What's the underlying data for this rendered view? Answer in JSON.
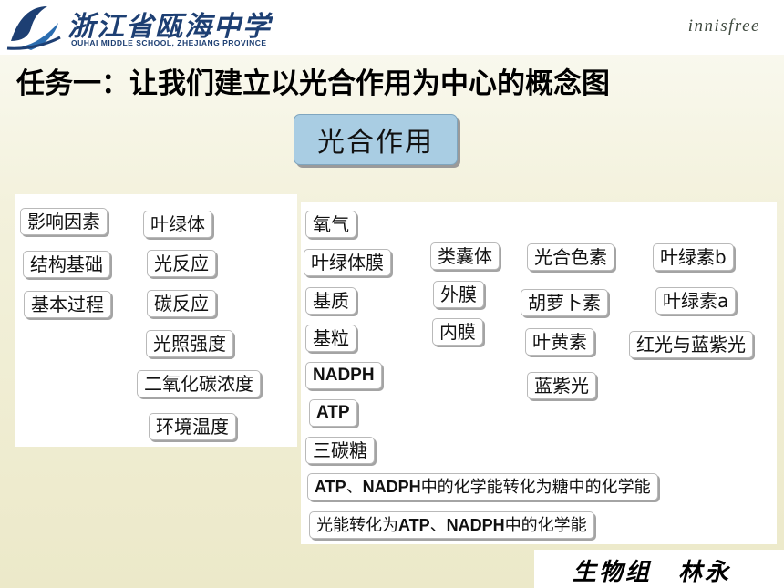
{
  "header": {
    "school_name_cn": "浙江省瓯海中学",
    "school_name_en": "OUHAI MIDDLE SCHOOL, ZHEJIANG PROVINCE",
    "brand": "innisfree"
  },
  "title": "任务一：让我们建立以光合作用为中心的概念图",
  "center_concept": "光合作用",
  "left_terms": [
    "影响因素",
    "叶绿体",
    "结构基础",
    "光反应",
    "基本过程",
    "碳反应",
    "光照强度",
    "二氧化碳浓度",
    "环境温度"
  ],
  "right_terms": [
    "氧气",
    "叶绿体膜",
    "基质",
    "基粒",
    "NADPH",
    "ATP",
    "三碳糖",
    "类囊体",
    "外膜",
    "内膜",
    "光合色素",
    "胡萝卜素",
    "叶黄素",
    "蓝紫光",
    "叶绿素b",
    "叶绿素a",
    "红光与蓝紫光"
  ],
  "statements": {
    "s1": {
      "a": "ATP",
      "b": "、",
      "c": "NADPH",
      "d": "中的化学能转化为糖中的化学能"
    },
    "s2": {
      "a": "光能转化为",
      "b": "ATP",
      "c": "、",
      "d": "NADPH",
      "e": "中的化学能"
    }
  },
  "footer": {
    "signature": "生物组　林永"
  },
  "colors": {
    "center_box": "#a9cde3",
    "logo_blue": "#1d3f73",
    "background": "#ece9c9"
  }
}
